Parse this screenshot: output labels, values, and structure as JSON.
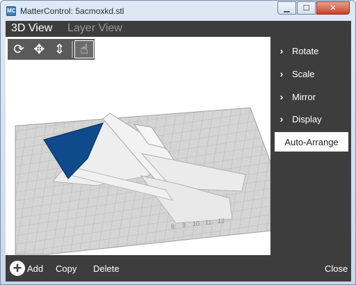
{
  "window": {
    "title": "MatterControl: 5acmoxkd.stl",
    "app_icon": "MC",
    "controls": {
      "minimize": "minimize-icon",
      "maximize": "maximize-icon",
      "close": "close-icon"
    }
  },
  "tabs": [
    {
      "label": "3D View",
      "active": true
    },
    {
      "label": "Layer View",
      "active": false
    }
  ],
  "view_toolbar": [
    {
      "icon": "rotate-icon",
      "glyph": "⟳"
    },
    {
      "icon": "move-icon",
      "glyph": "✥"
    },
    {
      "icon": "zoom-icon",
      "glyph": "⇕"
    },
    {
      "icon": "select-hand-icon",
      "glyph": "☝",
      "selected": true
    }
  ],
  "right_panel": {
    "items": [
      {
        "label": "Rotate",
        "icon": "chevron-right-icon"
      },
      {
        "label": "Scale",
        "icon": "chevron-right-icon"
      },
      {
        "label": "Mirror",
        "icon": "chevron-right-icon"
      },
      {
        "label": "Display",
        "icon": "chevron-right-icon"
      }
    ],
    "auto_arrange": "Auto-Arrange"
  },
  "bottom_bar": {
    "add": "Add",
    "copy": "Copy",
    "delete": "Delete",
    "close": "Close"
  },
  "bed_ruler": [
    "8",
    "9",
    "10",
    "11",
    "12"
  ],
  "colors": {
    "panel": "#3d3d3d",
    "selected_part": "#0e4a8c",
    "part": "#ececec",
    "bed": "#d4d4d4",
    "grid": "#b6b6b6"
  }
}
